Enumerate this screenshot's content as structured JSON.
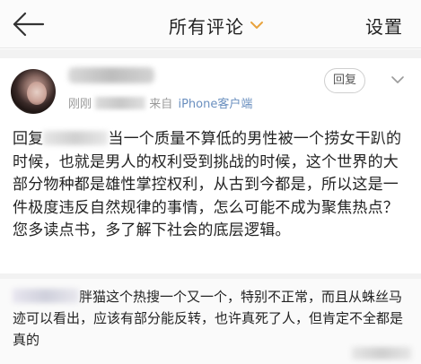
{
  "header": {
    "title": "所有评论",
    "settings_label": "设置"
  },
  "comment": {
    "time": "刚刚",
    "from_label": "来自",
    "source": "iPhone客户端",
    "reply_button": "回复",
    "reply_prefix": "回复",
    "body": "当一个质量不算低的男性被一个捞女干趴的时候，也就是男人的权利受到挑战的时候，这个世界的大部分物种都是雄性掌控权利，从古到今都是，所以这是一件极度违反自然规律的事情，怎么可能不成为聚焦热点？您多读点书，多了解下社会的底层逻辑。"
  },
  "sub_comment": {
    "body": "胖猫这个热搜一个又一个，特别不正常，而且从蛛丝马迹可以看出，应该有部分能反转，也许真死了人，但肯定不全都是真的"
  },
  "colors": {
    "accent": "#e8a33d",
    "link": "#6a8fbf",
    "text": "#222222",
    "muted": "#9a9a9a"
  },
  "icons": {
    "back": "back-arrow-icon",
    "title_caret": "chevron-down-icon",
    "more": "chevron-down-icon"
  }
}
